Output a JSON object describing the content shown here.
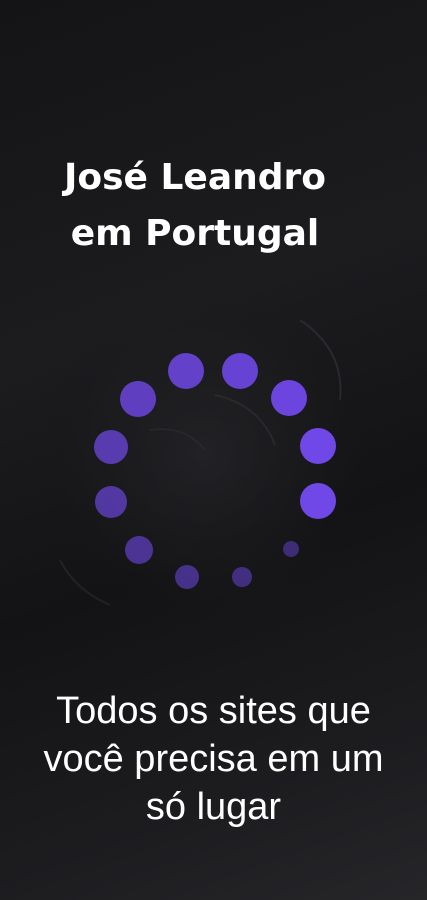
{
  "splash": {
    "title_line1": "José Leandro",
    "title_line2": "em Portugal",
    "tagline_line1": "Todos os sites que",
    "tagline_line2": "você precisa em um",
    "tagline_line3": "só lugar"
  },
  "colors": {
    "background": "#18181b",
    "spinner_dot": "#7048e8",
    "text": "#ffffff"
  },
  "spinner": {
    "icon": "loading-spinner-icon",
    "dot_count": 12
  }
}
